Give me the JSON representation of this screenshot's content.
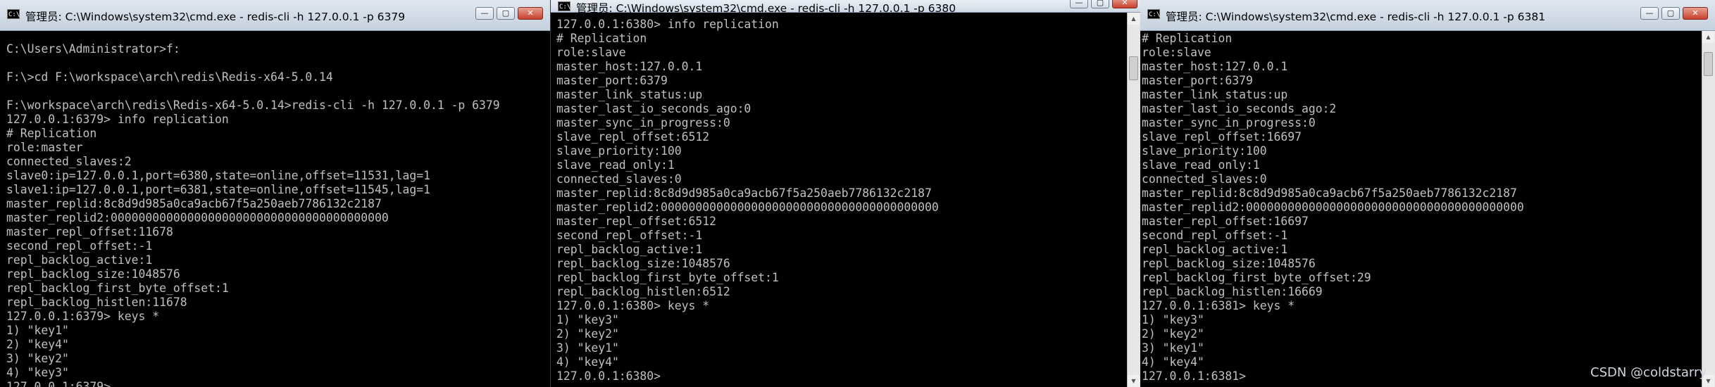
{
  "windows": [
    {
      "title": "管理员: C:\\Windows\\system32\\cmd.exe - redis-cli  -h 127.0.0.1 -p 6379",
      "output": "C:\\Users\\Administrator>f:\n\nF:\\>cd F:\\workspace\\arch\\redis\\Redis-x64-5.0.14\n\nF:\\workspace\\arch\\redis\\Redis-x64-5.0.14>redis-cli -h 127.0.0.1 -p 6379\n127.0.0.1:6379> info replication\n# Replication\nrole:master\nconnected_slaves:2\nslave0:ip=127.0.0.1,port=6380,state=online,offset=11531,lag=1\nslave1:ip=127.0.0.1,port=6381,state=online,offset=11545,lag=1\nmaster_replid:8c8d9d985a0ca9acb67f5a250aeb7786132c2187\nmaster_replid2:0000000000000000000000000000000000000000\nmaster_repl_offset:11678\nsecond_repl_offset:-1\nrepl_backlog_active:1\nrepl_backlog_size:1048576\nrepl_backlog_first_byte_offset:1\nrepl_backlog_histlen:11678\n127.0.0.1:6379> keys *\n1) \"key1\"\n2) \"key4\"\n3) \"key2\"\n4) \"key3\"\n127.0.0.1:6379>"
    },
    {
      "title": "管理员: C:\\Windows\\system32\\cmd.exe - redis-cli  -h 127.0.0.1 -p 6380",
      "output": "127.0.0.1:6380> info replication\n# Replication\nrole:slave\nmaster_host:127.0.0.1\nmaster_port:6379\nmaster_link_status:up\nmaster_last_io_seconds_ago:0\nmaster_sync_in_progress:0\nslave_repl_offset:6512\nslave_priority:100\nslave_read_only:1\nconnected_slaves:0\nmaster_replid:8c8d9d985a0ca9acb67f5a250aeb7786132c2187\nmaster_replid2:0000000000000000000000000000000000000000\nmaster_repl_offset:6512\nsecond_repl_offset:-1\nrepl_backlog_active:1\nrepl_backlog_size:1048576\nrepl_backlog_first_byte_offset:1\nrepl_backlog_histlen:6512\n127.0.0.1:6380> keys *\n1) \"key3\"\n2) \"key2\"\n3) \"key1\"\n4) \"key4\"\n127.0.0.1:6380>"
    },
    {
      "title": "管理员: C:\\Windows\\system32\\cmd.exe - redis-cli  -h 127.0.0.1 -p 6381",
      "output": "# Replication\nrole:slave\nmaster_host:127.0.0.1\nmaster_port:6379\nmaster_link_status:up\nmaster_last_io_seconds_ago:2\nmaster_sync_in_progress:0\nslave_repl_offset:16697\nslave_priority:100\nslave_read_only:1\nconnected_slaves:0\nmaster_replid:8c8d9d985a0ca9acb67f5a250aeb7786132c2187\nmaster_replid2:0000000000000000000000000000000000000000\nmaster_repl_offset:16697\nsecond_repl_offset:-1\nrepl_backlog_active:1\nrepl_backlog_size:1048576\nrepl_backlog_first_byte_offset:29\nrepl_backlog_histlen:16669\n127.0.0.1:6381> keys *\n1) \"key3\"\n2) \"key2\"\n3) \"key1\"\n4) \"key4\"\n127.0.0.1:6381>"
    }
  ],
  "app_icon_text": "C:\\",
  "window_buttons": {
    "minimize": "—",
    "maximize": "▢",
    "close": "✕"
  },
  "scroll": {
    "up": "▲",
    "down": "▼"
  },
  "watermark": "CSDN @coldstarry",
  "icons": {
    "app": "cmd-icon",
    "minimize": "minimize-icon",
    "maximize": "maximize-icon",
    "close": "close-icon"
  }
}
